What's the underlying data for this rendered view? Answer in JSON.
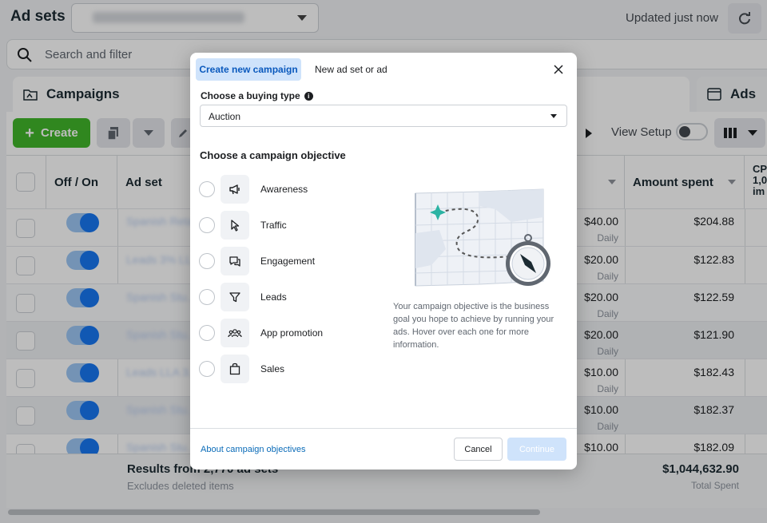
{
  "header": {
    "title": "Ad sets",
    "account_selector": "",
    "updated_text": "Updated just now"
  },
  "search": {
    "placeholder": "Search and filter"
  },
  "tabs": {
    "campaigns": "Campaigns",
    "ads": "Ads"
  },
  "toolbar": {
    "create_label": "Create",
    "view_setup_label": "View Setup"
  },
  "table": {
    "headers": {
      "off_on": "Off / On",
      "ad_set": "Ad set",
      "amount_spent": "Amount spent",
      "cpm": "CP 1,0 im"
    },
    "rows": [
      {
        "name": "Spanish Reta...",
        "budget": "$40.00",
        "budget_type": "Daily",
        "spent": "$204.88"
      },
      {
        "name": "Leads 3% LL...",
        "budget": "$20.00",
        "budget_type": "Daily",
        "spent": "$122.83"
      },
      {
        "name": "Spanish Stu...",
        "budget": "$20.00",
        "budget_type": "Daily",
        "spent": "$122.59"
      },
      {
        "name": "Spanish Stu...",
        "budget": "$20.00",
        "budget_type": "Daily",
        "spent": "$121.90"
      },
      {
        "name": "Leads LLA 3...",
        "budget": "$10.00",
        "budget_type": "Daily",
        "spent": "$182.43"
      },
      {
        "name": "Spanish Stu...",
        "budget": "$10.00",
        "budget_type": "Daily",
        "spent": "$182.37"
      },
      {
        "name": "Spanish Stu...",
        "budget": "$10.00",
        "budget_type": "",
        "spent": "$182.09"
      }
    ],
    "results": {
      "title": "Results from 2,770 ad sets",
      "subtitle": "Excludes deleted items",
      "total_spent": "$1,044,632.90",
      "total_spent_label": "Total Spent"
    }
  },
  "modal": {
    "tab_active": "Create new campaign",
    "tab_other": "New ad set or ad",
    "buying_type_label": "Choose a buying type",
    "buying_type_value": "Auction",
    "objective_heading": "Choose a campaign objective",
    "objectives": [
      {
        "label": "Awareness",
        "icon": "megaphone-icon"
      },
      {
        "label": "Traffic",
        "icon": "cursor-icon"
      },
      {
        "label": "Engagement",
        "icon": "chat-bubble-icon"
      },
      {
        "label": "Leads",
        "icon": "filter-icon"
      },
      {
        "label": "App promotion",
        "icon": "people-icon"
      },
      {
        "label": "Sales",
        "icon": "shopping-bag-icon"
      }
    ],
    "description": "Your campaign objective is the business goal you hope to achieve by running your ads. Hover over each one for more information.",
    "about_link": "About campaign objectives",
    "cancel_label": "Cancel",
    "continue_label": "Continue"
  },
  "colors": {
    "accent": "#1877f2",
    "create_green": "#42b72a",
    "tab_active_bg": "#cfe3fb",
    "link": "#0a6bb8"
  }
}
